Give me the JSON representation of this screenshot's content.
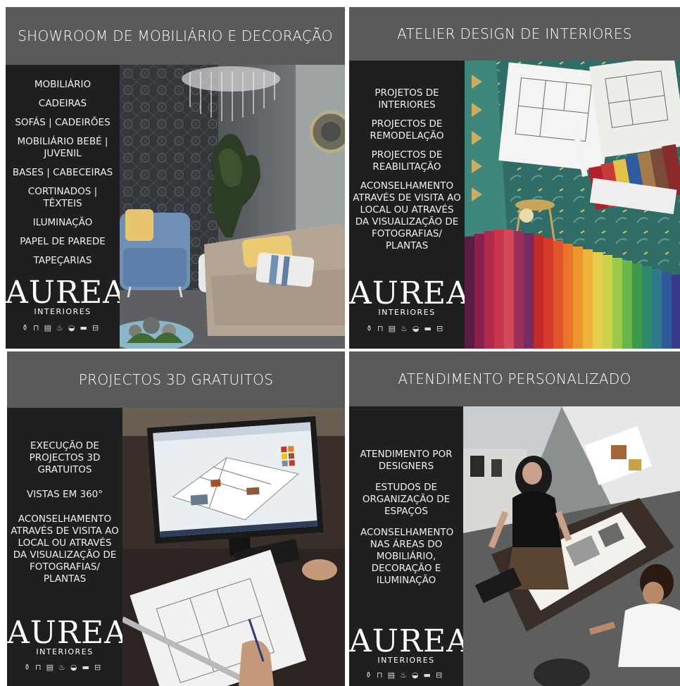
{
  "brand": {
    "name": "AUREA",
    "sub": "INTERIORES",
    "icons": [
      "⚱",
      "⊓",
      "▤",
      "♨",
      "◒",
      "▬",
      "⊟"
    ]
  },
  "panels": [
    {
      "title": "SHOWROOM DE MOBILIÁRIO E DECORAÇÃO",
      "items": [
        "MOBILIÁRIO",
        "CADEIRAS",
        "SOFÁS | CADEIRÕES",
        "MOBILIÁRIO BEBÉ | JUVENIL",
        "BASES | CABECEIRAS",
        "CORTINADOS | TÊXTEIS",
        "ILUMINAÇÃO",
        "PAPEL DE PAREDE",
        "TAPEÇARIAS"
      ]
    },
    {
      "title": "ATELIER DESIGN DE INTERIORES",
      "items": [
        "PROJETOS DE INTERIORES",
        "PROJECTOS DE REMODELAÇÃO",
        "PROJECTOS DE REABILITAÇÃO",
        "ACONSELHAMENTO ATRAVÉS DE VISITA AO LOCAL OU ATRAVÉS DA VISUALIZAÇÃO DE FOTOGRAFIAS/ PLANTAS"
      ]
    },
    {
      "title": "PROJECTOS 3D GRATUITOS",
      "items": [
        "EXECUÇÃO DE PROJECTOS 3D GRATUITOS",
        "VISTAS EM 360°",
        "ACONSELHAMENTO ATRAVÉS DE VISITA AO LOCAL OU ATRAVÉS DA VISUALIZAÇÃO DE FOTOGRAFIAS/ PLANTAS"
      ]
    },
    {
      "title": "ATENDIMENTO PERSONALIZADO",
      "items": [
        "ATENDIMENTO POR DESIGNERS",
        "ESTUDOS DE ORGANIZAÇÃO DE ESPAÇOS",
        "ACONSELHAMENTO NAS ÁREAS DO MOBILIÁRIO, DECORAÇÃO E ILUMINAÇÃO"
      ]
    }
  ]
}
